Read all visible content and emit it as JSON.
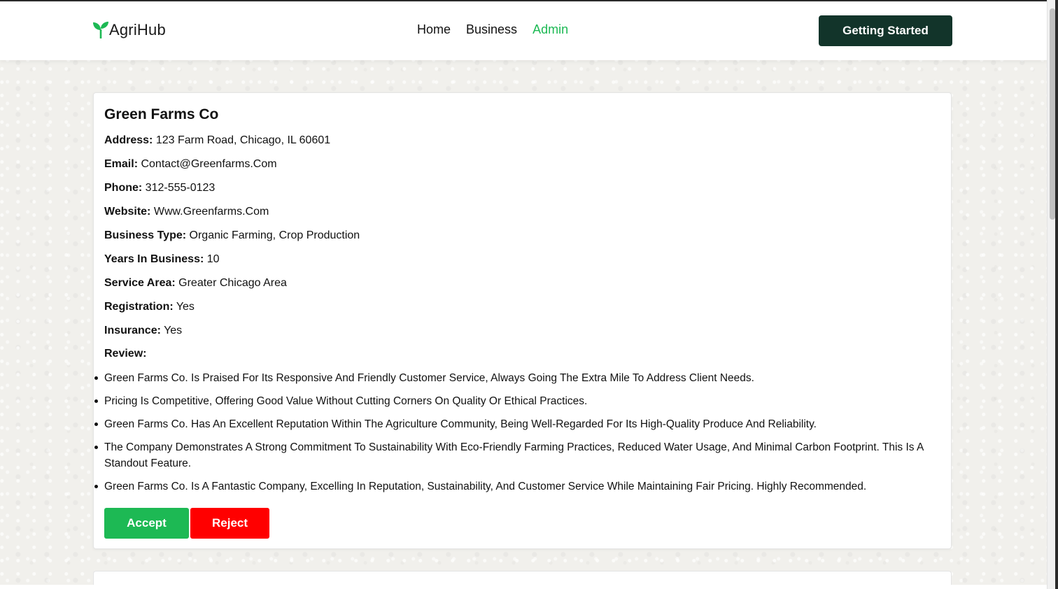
{
  "navbar": {
    "brand": "AgriHub",
    "links": [
      "Home",
      "Business",
      "Admin"
    ],
    "active_link": "Admin",
    "cta": "Getting Started"
  },
  "colors": {
    "accent_green": "#1db954",
    "cta_bg": "#12342a",
    "reject_red": "#ff0000"
  },
  "business": {
    "name": "Green Farms Co",
    "fields": [
      {
        "label": "Address:",
        "value": "123 Farm Road, Chicago, IL 60601"
      },
      {
        "label": "Email:",
        "value": "Contact@Greenfarms.Com"
      },
      {
        "label": "Phone:",
        "value": "312-555-0123"
      },
      {
        "label": "Website:",
        "value": "Www.Greenfarms.Com"
      },
      {
        "label": "Business Type:",
        "value": "Organic Farming, Crop Production"
      },
      {
        "label": "Years In Business:",
        "value": "10"
      },
      {
        "label": "Service Area:",
        "value": "Greater Chicago Area"
      },
      {
        "label": "Registration:",
        "value": "Yes"
      },
      {
        "label": "Insurance:",
        "value": "Yes"
      }
    ],
    "review_label": "Review:",
    "reviews": [
      "Green Farms Co. Is Praised For Its Responsive And Friendly Customer Service, Always Going The Extra Mile To Address Client Needs.",
      "Pricing Is Competitive, Offering Good Value Without Cutting Corners On Quality Or Ethical Practices.",
      "Green Farms Co. Has An Excellent Reputation Within The Agriculture Community, Being Well-Regarded For Its High-Quality Produce And Reliability.",
      "The Company Demonstrates A Strong Commitment To Sustainability With Eco-Friendly Farming Practices, Reduced Water Usage, And Minimal Carbon Footprint. This Is A Standout Feature.",
      "Green Farms Co. Is A Fantastic Company, Excelling In Reputation, Sustainability, And Customer Service While Maintaining Fair Pricing. Highly Recommended."
    ],
    "accept_label": "Accept",
    "reject_label": "Reject"
  }
}
